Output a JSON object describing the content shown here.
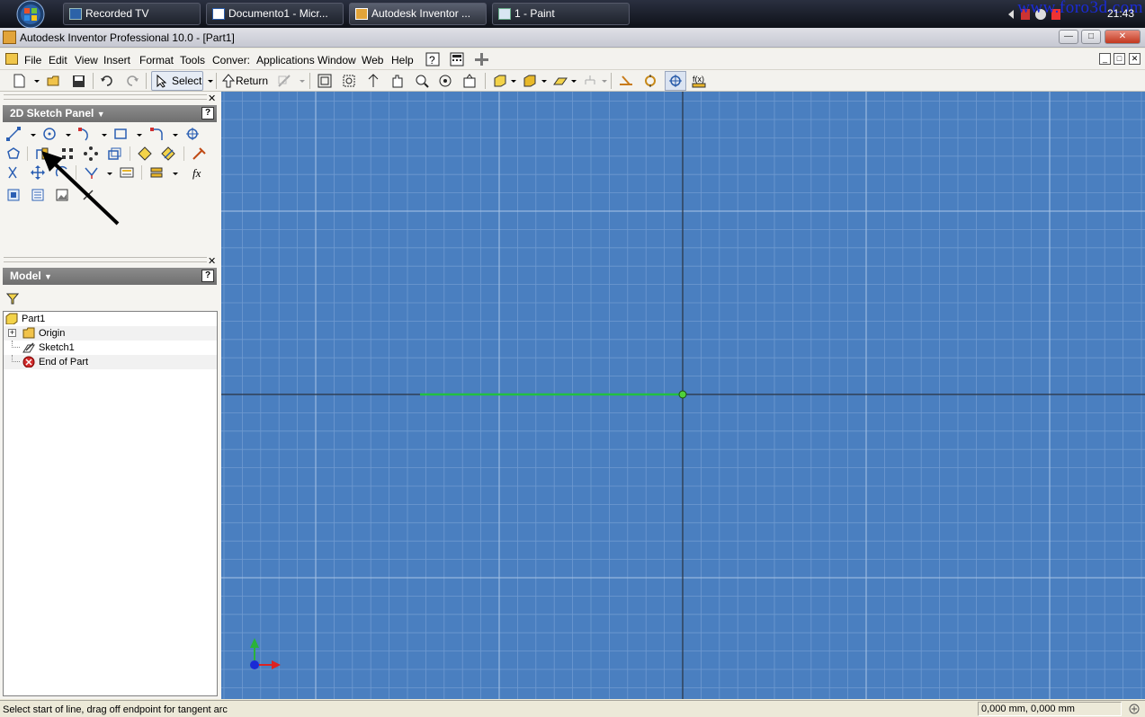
{
  "taskbar": {
    "buttons": [
      "Recorded TV",
      "Documento1 - Micr...",
      "Autodesk Inventor ...",
      "1 - Paint"
    ],
    "watermark": "www.foro3d.com",
    "clock": "21:43"
  },
  "window": {
    "title": "Autodesk Inventor Professional 10.0 - [Part1]"
  },
  "menu": {
    "items": [
      "File",
      "Edit",
      "View",
      "Insert",
      "Format",
      "Tools",
      "Conver:",
      "Applications",
      "Window",
      "Web",
      "Help"
    ]
  },
  "toolbar": {
    "select_label": "Select",
    "return_label": "Return"
  },
  "sketch_panel": {
    "title": "2D Sketch Panel",
    "help": "?"
  },
  "model_panel": {
    "title": "Model",
    "help": "?",
    "tree": [
      "Part1",
      "Origin",
      "Sketch1",
      "End of Part"
    ]
  },
  "status": {
    "text": "Select start of line, drag off endpoint for tangent arc",
    "coords": "0,000 mm, 0,000 mm"
  },
  "colors": {
    "canvas_background": "#4a7fc0",
    "grid_minor": "#6f9ad0",
    "grid_major": "#a9c4e6",
    "axis_line": "#2a3340",
    "sketch_line": "#22c040",
    "panel_header": "#7a7a7a"
  }
}
